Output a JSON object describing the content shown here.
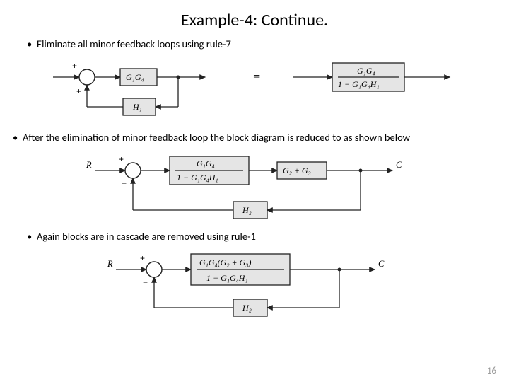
{
  "title": "Example-4: Continue.",
  "bullet1": "Eliminate all minor feedback loops using rule-7",
  "bullet2": "After the elimination of minor feedback loop the block diagram is reduced to as shown below",
  "bullet3": "Again blocks are in cascade are removed using rule-1",
  "page_number": "16",
  "diagram1": {
    "sum_top_plus": "+",
    "sum_bottom_plus": "+",
    "block_g": "G₁G₄",
    "block_h": "H₁",
    "equiv": "≡",
    "result_num": "G₁G₄",
    "result_den_pre": "1 − ",
    "result_den_post": "G₁G₄H₁"
  },
  "diagram2": {
    "R": "R",
    "C": "C",
    "plus": "+",
    "minus": "−",
    "block1_num": "G₁G₄",
    "block1_den_pre": "1 − ",
    "block1_den_post": "G₁G₄H₁",
    "block2": "G₂ + G₃",
    "block_h": "H₂"
  },
  "diagram3": {
    "R": "R",
    "C": "C",
    "plus": "+",
    "minus": "−",
    "block_num_a": "G₁G₄(",
    "block_num_b": "G₂ + G₃",
    "block_num_c": ")",
    "block_den_pre": "1 − ",
    "block_den_post": "G₁G₄H₁",
    "block_h": "H₂"
  }
}
